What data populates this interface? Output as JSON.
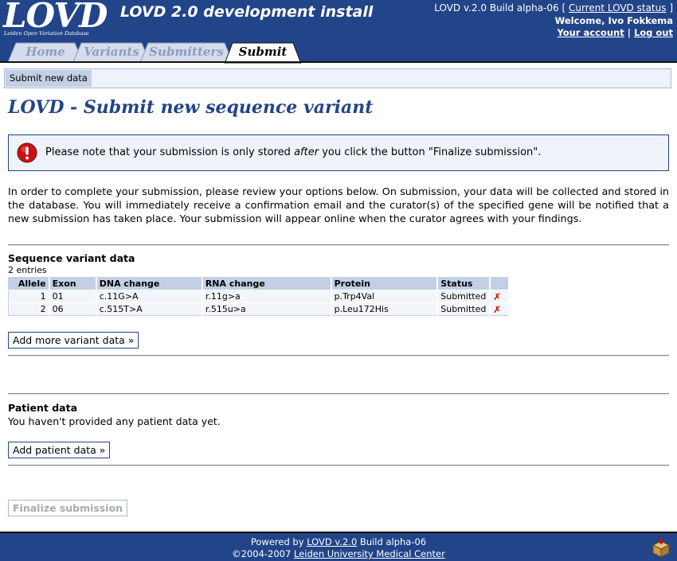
{
  "header": {
    "logo_text": "LOVD",
    "logo_subtitle": "Leiden Open Variation Database",
    "site_title": "LOVD 2.0 development install",
    "build_prefix": "LOVD v.2.0 Build alpha-06 [",
    "status_link": "Current LOVD status",
    "build_suffix": "]",
    "welcome": "Welcome, Ivo Fokkema",
    "account_link": "Your account",
    "separator": "|",
    "logout_link": "Log out"
  },
  "tabs": [
    {
      "label": "Home",
      "active": false
    },
    {
      "label": "Variants",
      "active": false
    },
    {
      "label": "Submitters",
      "active": false
    },
    {
      "label": "Submit",
      "active": true
    }
  ],
  "subnav": {
    "item": "Submit new data"
  },
  "page_title": "LOVD - Submit new sequence variant",
  "notice": {
    "before": "Please note that your submission is only stored ",
    "emphasis": "after",
    "after": " you click the button \"Finalize submission\"."
  },
  "intro": "In order to complete your submission, please review your options below. On submission, your data will be collected and stored in the database. You will immediately receive a confirmation email and the curator(s) of the specified gene will be notified that a new submission has taken place. Your submission will appear online when the curator agrees with your findings.",
  "variants": {
    "title": "Sequence variant data",
    "count": "2 entries",
    "columns": [
      "Allele",
      "Exon",
      "DNA change",
      "RNA change",
      "Protein",
      "Status",
      ""
    ],
    "rows": [
      {
        "allele": "1",
        "exon": "01",
        "dna": "c.11G>A",
        "rna": "r.11g>a",
        "protein": "p.Trp4Val",
        "status": "Submitted"
      },
      {
        "allele": "2",
        "exon": "06",
        "dna": "c.515T>A",
        "rna": "r.515u>a",
        "protein": "p.Leu172His",
        "status": "Submitted"
      }
    ],
    "delete_glyph": "✗",
    "add_button": "Add more variant data »"
  },
  "patient": {
    "title": "Patient data",
    "message": "You haven't provided any patient data yet.",
    "add_button": "Add patient data »"
  },
  "finalize_button": "Finalize submission",
  "footer": {
    "powered_prefix": "Powered by ",
    "lovd_link": "LOVD v.2.0",
    "powered_suffix": " Build alpha-06",
    "copyright_prefix": "©2004-2007 ",
    "lumc_link": "Leiden University Medical Center"
  },
  "colors": {
    "brand": "#224488",
    "light": "#eef2f9",
    "table_header": "#c3cfe4",
    "delete": "#cc0000"
  },
  "icons": {
    "notice": "error-icon",
    "delete": "delete-icon",
    "footer": "package-icon"
  }
}
